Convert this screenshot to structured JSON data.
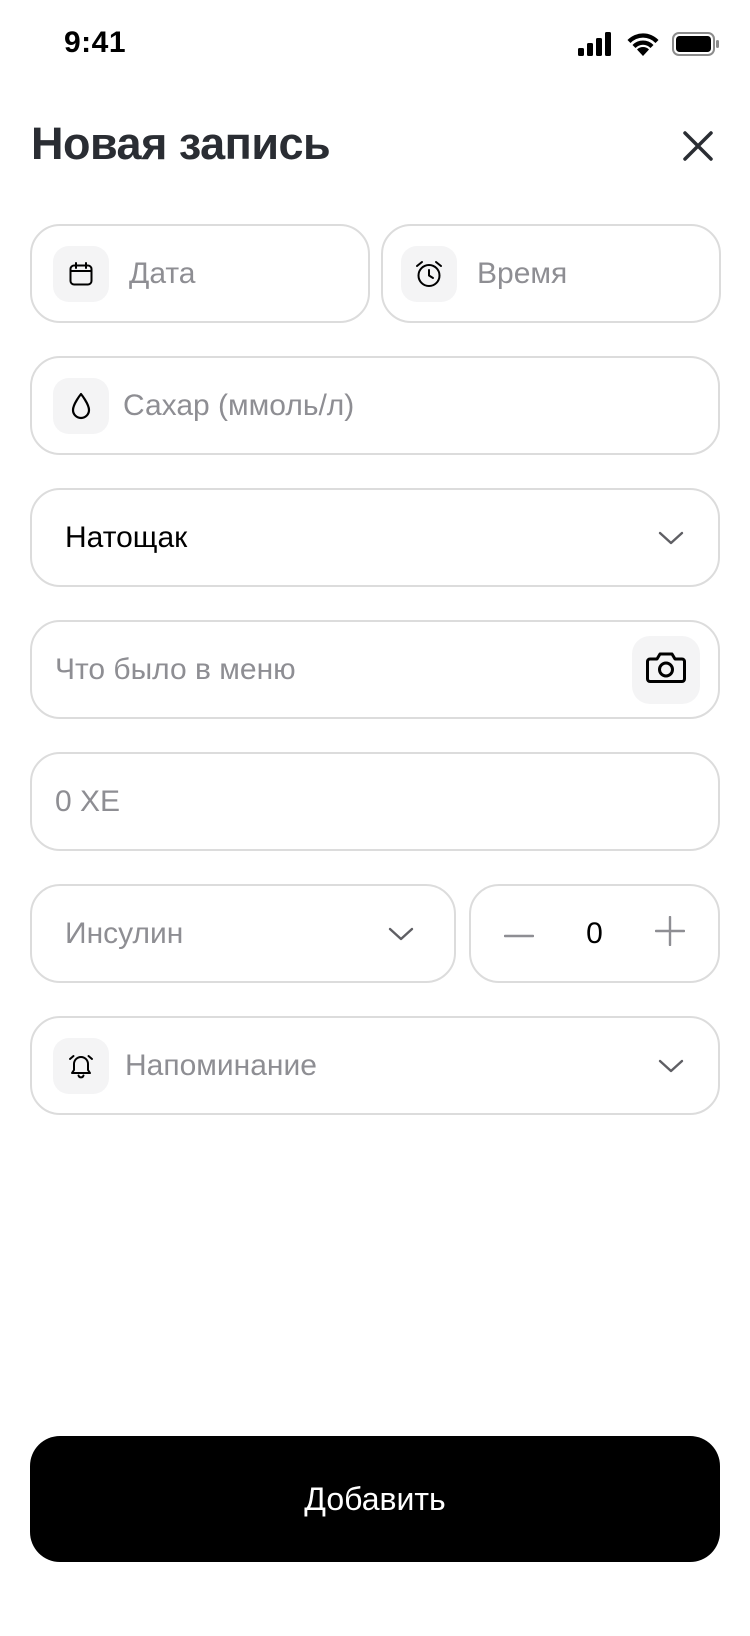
{
  "status_bar": {
    "time": "9:41",
    "icons": [
      "cellular-signal-icon",
      "wifi-icon",
      "battery-icon"
    ]
  },
  "header": {
    "title": "Новая запись",
    "close_icon": "close-icon"
  },
  "form": {
    "date": {
      "placeholder": "Дата",
      "icon": "calendar-icon"
    },
    "time": {
      "placeholder": "Время",
      "icon": "alarm-clock-icon"
    },
    "sugar": {
      "placeholder": "Сахар (ммоль/л)",
      "icon": "drop-icon"
    },
    "meal_state": {
      "value": "Натощак",
      "icon": "chevron-down-icon"
    },
    "menu": {
      "placeholder": "Что было в меню",
      "icon": "camera-icon"
    },
    "xe": {
      "placeholder": "0 ХЕ"
    },
    "insulin": {
      "placeholder": "Инсулин",
      "icon": "chevron-down-icon"
    },
    "insulin_dose": {
      "value": "0",
      "minus_icon": "minus-icon",
      "plus_icon": "plus-icon"
    },
    "reminder": {
      "placeholder": "Напоминание",
      "icon": "bell-icon"
    }
  },
  "actions": {
    "submit_label": "Добавить"
  },
  "colors": {
    "title": "#2a2d33",
    "placeholder": "#8e8e93",
    "border": "#dcdcdc",
    "icon_bg": "#f4f4f5",
    "button_bg": "#000000",
    "button_text": "#ffffff"
  }
}
